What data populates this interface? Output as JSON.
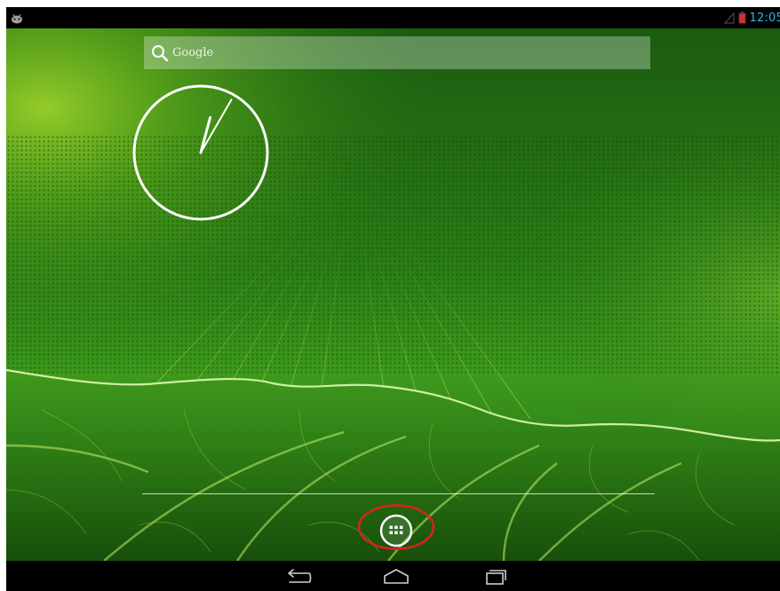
{
  "status_bar": {
    "time": "12:05",
    "left_icon": "android-notification-icon",
    "signal_icon": "signal-icon",
    "battery_icon": "battery-low-icon",
    "time_color": "#33b5e5",
    "battery_color": "#d32f2f"
  },
  "search": {
    "placeholder": "Google",
    "icon": "search-icon"
  },
  "clock": {
    "type": "analog",
    "hour_hand_angle_deg": 15,
    "minute_hand_angle_deg": 30
  },
  "dock": {
    "all_apps_icon": "all-apps-grid-icon",
    "highlight_color": "#e02020"
  },
  "nav_bar": {
    "back_icon": "back-icon",
    "home_icon": "home-icon",
    "recents_icon": "recent-apps-icon"
  },
  "wallpaper": {
    "description_colors": [
      "#0d4a0a",
      "#2f8a17",
      "#7fc021",
      "#1e6a12"
    ]
  }
}
